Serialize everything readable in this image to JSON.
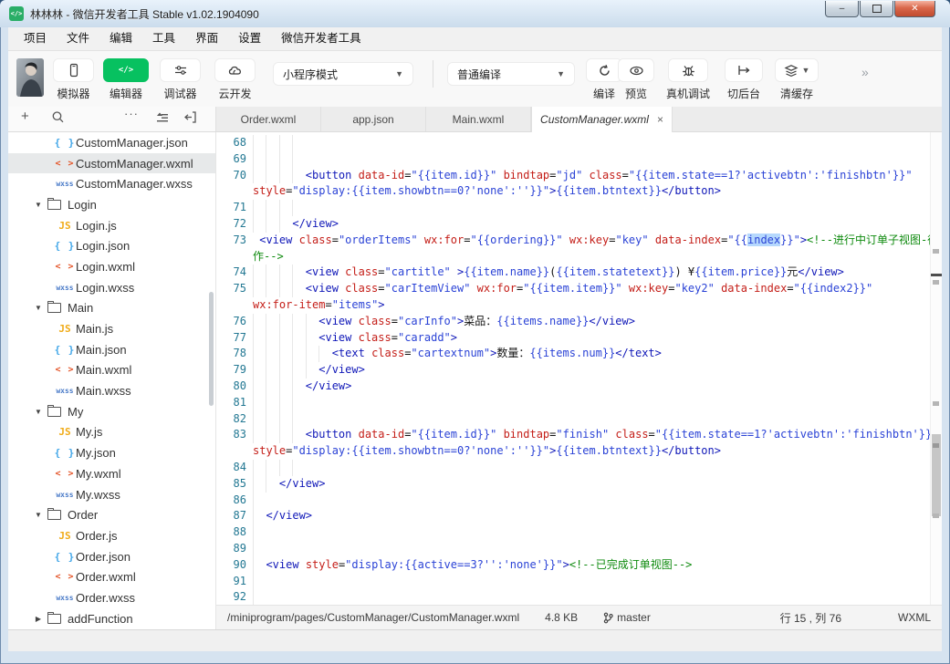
{
  "window": {
    "title": "林林林 - 微信开发者工具 Stable v1.02.1904090",
    "buttons": {
      "minimize": "–",
      "maximize": "",
      "close": "✕"
    }
  },
  "colors": {
    "green": "#07c160",
    "tag": "#1018b8",
    "attr": "#c41e18",
    "str": "#2b43d6",
    "comment": "#0e8a0e",
    "selection": "#b5d8fd",
    "line_number": "#237893"
  },
  "menu": {
    "items": [
      "项目",
      "文件",
      "编辑",
      "工具",
      "界面",
      "设置",
      "微信开发者工具"
    ]
  },
  "toolbar": {
    "tool_buttons": [
      {
        "icon": "phone-icon",
        "label": "模拟器"
      },
      {
        "icon": "code-icon",
        "label": "编辑器",
        "active": true
      },
      {
        "icon": "sliders-icon",
        "label": "调试器"
      },
      {
        "icon": "cloud-icon",
        "label": "云开发"
      }
    ],
    "mode_select": "小程序模式",
    "compile_select": "普通编译",
    "action_buttons": [
      {
        "icon": "refresh-icon",
        "label": "编译"
      },
      {
        "icon": "eye-icon",
        "label": "预览"
      },
      {
        "icon": "bug-icon",
        "label": "真机调试"
      },
      {
        "icon": "switch-background-icon",
        "label": "切后台"
      },
      {
        "icon": "layers-icon",
        "label": "清缓存",
        "caret": true
      }
    ],
    "overflow": "»"
  },
  "sidebar": {
    "tree": [
      {
        "type": "file",
        "kind": "json",
        "name": "CustomManager.json"
      },
      {
        "type": "file",
        "kind": "wxml",
        "name": "CustomManager.wxml",
        "selected": true
      },
      {
        "type": "file",
        "kind": "wxss",
        "name": "CustomManager.wxss"
      },
      {
        "type": "folder",
        "name": "Login",
        "open": true
      },
      {
        "type": "file",
        "kind": "js",
        "name": "Login.js"
      },
      {
        "type": "file",
        "kind": "json",
        "name": "Login.json"
      },
      {
        "type": "file",
        "kind": "wxml",
        "name": "Login.wxml"
      },
      {
        "type": "file",
        "kind": "wxss",
        "name": "Login.wxss"
      },
      {
        "type": "folder",
        "name": "Main",
        "open": true
      },
      {
        "type": "file",
        "kind": "js",
        "name": "Main.js"
      },
      {
        "type": "file",
        "kind": "json",
        "name": "Main.json"
      },
      {
        "type": "file",
        "kind": "wxml",
        "name": "Main.wxml"
      },
      {
        "type": "file",
        "kind": "wxss",
        "name": "Main.wxss"
      },
      {
        "type": "folder",
        "name": "My",
        "open": true
      },
      {
        "type": "file",
        "kind": "js",
        "name": "My.js"
      },
      {
        "type": "file",
        "kind": "json",
        "name": "My.json"
      },
      {
        "type": "file",
        "kind": "wxml",
        "name": "My.wxml"
      },
      {
        "type": "file",
        "kind": "wxss",
        "name": "My.wxss"
      },
      {
        "type": "folder",
        "name": "Order",
        "open": true
      },
      {
        "type": "file",
        "kind": "js",
        "name": "Order.js"
      },
      {
        "type": "file",
        "kind": "json",
        "name": "Order.json"
      },
      {
        "type": "file",
        "kind": "wxml",
        "name": "Order.wxml"
      },
      {
        "type": "file",
        "kind": "wxss",
        "name": "Order.wxss"
      },
      {
        "type": "folder",
        "name": "addFunction",
        "open": false
      }
    ]
  },
  "tabs": [
    {
      "label": "Order.wxml"
    },
    {
      "label": "app.json"
    },
    {
      "label": "Main.wxml"
    },
    {
      "label": "CustomManager.wxml",
      "active": true,
      "close": "×"
    }
  ],
  "editor": {
    "rows": [
      {
        "n": "68",
        "g": 4,
        "s": []
      },
      {
        "n": "69",
        "g": 4,
        "s": []
      },
      {
        "n": "70",
        "g": 4,
        "s": [
          [
            "tx",
            "        "
          ],
          [
            "tg",
            "<button"
          ],
          [
            "tx",
            " "
          ],
          [
            "at",
            "data-id"
          ],
          [
            "tx",
            "="
          ],
          [
            "st",
            "\"{{item.id}}\""
          ],
          [
            "tx",
            " "
          ],
          [
            "at",
            "bindtap"
          ],
          [
            "tx",
            "="
          ],
          [
            "st",
            "\"jd\""
          ],
          [
            "tx",
            " "
          ],
          [
            "at",
            "class"
          ],
          [
            "tx",
            "="
          ],
          [
            "st",
            "\"{{item.state==1?'activebtn':'finishbtn'}}\""
          ]
        ]
      },
      {
        "n": "",
        "g": 0,
        "s": [
          [
            "at",
            "style"
          ],
          [
            "tx",
            "="
          ],
          [
            "st",
            "\"display:{{item.showbtn==0?'none':''}}\""
          ],
          [
            "tg",
            ">"
          ],
          [
            "st",
            "{{item.btntext}}"
          ],
          [
            "tg",
            "</button>"
          ]
        ]
      },
      {
        "n": "71",
        "g": 4,
        "s": []
      },
      {
        "n": "72",
        "g": 3,
        "s": [
          [
            "tx",
            "      "
          ],
          [
            "tg",
            "</view>"
          ]
        ]
      },
      {
        "n": "73",
        "g": 0,
        "s": [
          [
            "tx",
            " "
          ],
          [
            "tg",
            "<view"
          ],
          [
            "tx",
            " "
          ],
          [
            "at",
            "class"
          ],
          [
            "tx",
            "="
          ],
          [
            "st",
            "\"orderItems\""
          ],
          [
            "tx",
            " "
          ],
          [
            "at",
            "wx:for"
          ],
          [
            "tx",
            "="
          ],
          [
            "st",
            "\"{{ordering}}\""
          ],
          [
            "tx",
            " "
          ],
          [
            "at",
            "wx:key"
          ],
          [
            "tx",
            "="
          ],
          [
            "st",
            "\"key\""
          ],
          [
            "tx",
            " "
          ],
          [
            "at",
            "data-index"
          ],
          [
            "tx",
            "="
          ],
          [
            "st",
            "\"{{"
          ],
          [
            "hl",
            "index"
          ],
          [
            "st",
            "}}\""
          ],
          [
            "tg",
            ">"
          ],
          [
            "cm",
            "<!--进行中订单子视图-待制"
          ]
        ]
      },
      {
        "n": "",
        "g": 0,
        "s": [
          [
            "cm",
            "作-->"
          ]
        ]
      },
      {
        "n": "74",
        "g": 4,
        "s": [
          [
            "tx",
            "        "
          ],
          [
            "tg",
            "<view"
          ],
          [
            "tx",
            " "
          ],
          [
            "at",
            "class"
          ],
          [
            "tx",
            "="
          ],
          [
            "st",
            "\"cartitle\""
          ],
          [
            "tx",
            " "
          ],
          [
            "tg",
            ">"
          ],
          [
            "st",
            "{{item.name}}"
          ],
          [
            "tx",
            "("
          ],
          [
            "st",
            "{{item.statetext}}"
          ],
          [
            "tx",
            ") ¥"
          ],
          [
            "st",
            "{{item.price}}"
          ],
          [
            "tx",
            "元"
          ],
          [
            "tg",
            "</view>"
          ]
        ]
      },
      {
        "n": "75",
        "g": 4,
        "s": [
          [
            "tx",
            "        "
          ],
          [
            "tg",
            "<view"
          ],
          [
            "tx",
            " "
          ],
          [
            "at",
            "class"
          ],
          [
            "tx",
            "="
          ],
          [
            "st",
            "\"carItemView\""
          ],
          [
            "tx",
            " "
          ],
          [
            "at",
            "wx:for"
          ],
          [
            "tx",
            "="
          ],
          [
            "st",
            "\"{{item.item}}\""
          ],
          [
            "tx",
            " "
          ],
          [
            "at",
            "wx:key"
          ],
          [
            "tx",
            "="
          ],
          [
            "st",
            "\"key2\""
          ],
          [
            "tx",
            " "
          ],
          [
            "at",
            "data-index"
          ],
          [
            "tx",
            "="
          ],
          [
            "st",
            "\"{{index2}}\""
          ]
        ]
      },
      {
        "n": "",
        "g": 0,
        "s": [
          [
            "at",
            "wx:for-item"
          ],
          [
            "tx",
            "="
          ],
          [
            "st",
            "\"items\""
          ],
          [
            "tg",
            ">"
          ]
        ]
      },
      {
        "n": "76",
        "g": 5,
        "s": [
          [
            "tx",
            "          "
          ],
          [
            "tg",
            "<view"
          ],
          [
            "tx",
            " "
          ],
          [
            "at",
            "class"
          ],
          [
            "tx",
            "="
          ],
          [
            "st",
            "\"carInfo\""
          ],
          [
            "tg",
            ">"
          ],
          [
            "tx",
            "菜品："
          ],
          [
            "st",
            "{{items.name}}"
          ],
          [
            "tg",
            "</view>"
          ]
        ]
      },
      {
        "n": "77",
        "g": 5,
        "s": [
          [
            "tx",
            "          "
          ],
          [
            "tg",
            "<view"
          ],
          [
            "tx",
            " "
          ],
          [
            "at",
            "class"
          ],
          [
            "tx",
            "="
          ],
          [
            "st",
            "\"caradd\""
          ],
          [
            "tg",
            ">"
          ]
        ]
      },
      {
        "n": "78",
        "g": 6,
        "s": [
          [
            "tx",
            "            "
          ],
          [
            "tg",
            "<text"
          ],
          [
            "tx",
            " "
          ],
          [
            "at",
            "class"
          ],
          [
            "tx",
            "="
          ],
          [
            "st",
            "\"cartextnum\""
          ],
          [
            "tg",
            ">"
          ],
          [
            "tx",
            "数量："
          ],
          [
            "st",
            "{{items.num}}"
          ],
          [
            "tg",
            "</text>"
          ]
        ]
      },
      {
        "n": "79",
        "g": 5,
        "s": [
          [
            "tx",
            "          "
          ],
          [
            "tg",
            "</view>"
          ]
        ]
      },
      {
        "n": "80",
        "g": 4,
        "s": [
          [
            "tx",
            "        "
          ],
          [
            "tg",
            "</view>"
          ]
        ]
      },
      {
        "n": "81",
        "g": 4,
        "s": []
      },
      {
        "n": "82",
        "g": 4,
        "s": []
      },
      {
        "n": "83",
        "g": 4,
        "s": [
          [
            "tx",
            "        "
          ],
          [
            "tg",
            "<button"
          ],
          [
            "tx",
            " "
          ],
          [
            "at",
            "data-id"
          ],
          [
            "tx",
            "="
          ],
          [
            "st",
            "\"{{item.id}}\""
          ],
          [
            "tx",
            " "
          ],
          [
            "at",
            "bindtap"
          ],
          [
            "tx",
            "="
          ],
          [
            "st",
            "\"finish\""
          ],
          [
            "tx",
            " "
          ],
          [
            "at",
            "class"
          ],
          [
            "tx",
            "="
          ],
          [
            "st",
            "\"{{item.state==1?'activebtn':'finishbtn'}}\""
          ]
        ]
      },
      {
        "n": "",
        "g": 0,
        "s": [
          [
            "at",
            "style"
          ],
          [
            "tx",
            "="
          ],
          [
            "st",
            "\"display:{{item.showbtn==0?'none':''}}\""
          ],
          [
            "tg",
            ">"
          ],
          [
            "st",
            "{{item.btntext}}"
          ],
          [
            "tg",
            "</button>"
          ]
        ]
      },
      {
        "n": "84",
        "g": 4,
        "s": []
      },
      {
        "n": "85",
        "g": 2,
        "s": [
          [
            "tx",
            "    "
          ],
          [
            "tg",
            "</view>"
          ]
        ]
      },
      {
        "n": "86",
        "g": 1,
        "s": []
      },
      {
        "n": "87",
        "g": 1,
        "s": [
          [
            "tx",
            "  "
          ],
          [
            "tg",
            "</view>"
          ]
        ]
      },
      {
        "n": "88",
        "g": 1,
        "s": []
      },
      {
        "n": "89",
        "g": 1,
        "s": []
      },
      {
        "n": "90",
        "g": 1,
        "s": [
          [
            "tx",
            "  "
          ],
          [
            "tg",
            "<view"
          ],
          [
            "tx",
            " "
          ],
          [
            "at",
            "style"
          ],
          [
            "tx",
            "="
          ],
          [
            "st",
            "\"display:{{active==3?'':'none'}}\""
          ],
          [
            "tg",
            ">"
          ],
          [
            "cm",
            "<!--已完成订单视图-->"
          ]
        ]
      },
      {
        "n": "91",
        "g": 1,
        "s": []
      },
      {
        "n": "92",
        "g": 1,
        "s": []
      }
    ]
  },
  "status": {
    "path": "/miniprogram/pages/CustomManager/CustomManager.wxml",
    "size": "4.8 KB",
    "branch": "master",
    "cursor": "行 15 , 列 76",
    "language": "WXML"
  }
}
